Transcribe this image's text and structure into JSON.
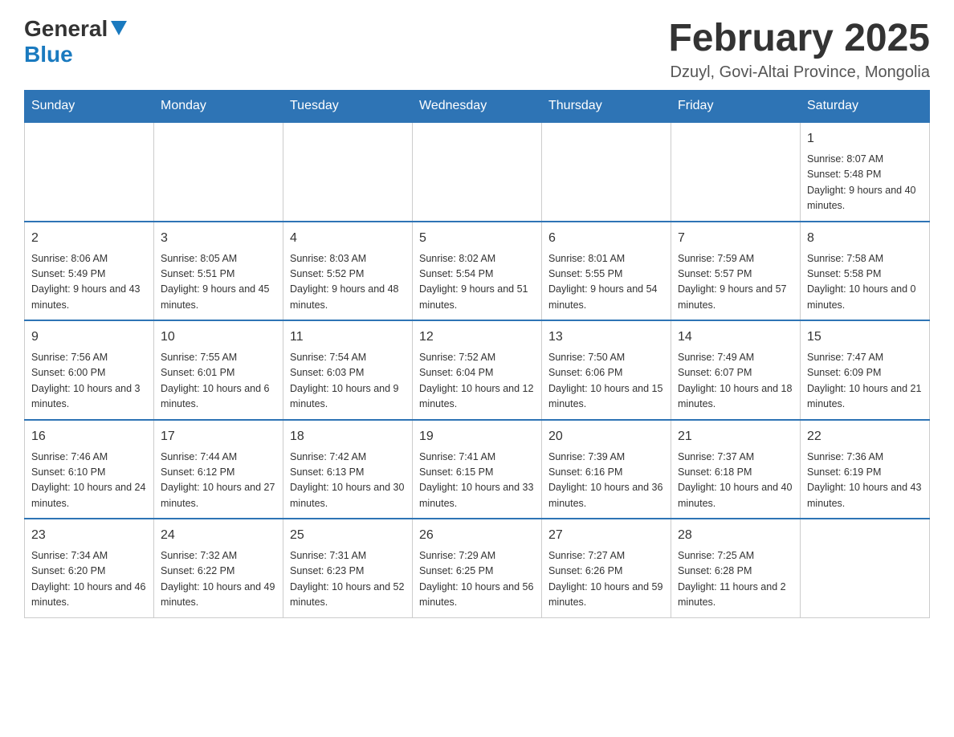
{
  "header": {
    "logo": {
      "general": "General",
      "blue": "Blue"
    },
    "title": "February 2025",
    "subtitle": "Dzuyl, Govi-Altai Province, Mongolia"
  },
  "weekdays": [
    "Sunday",
    "Monday",
    "Tuesday",
    "Wednesday",
    "Thursday",
    "Friday",
    "Saturday"
  ],
  "weeks": [
    [
      {
        "day": "",
        "info": ""
      },
      {
        "day": "",
        "info": ""
      },
      {
        "day": "",
        "info": ""
      },
      {
        "day": "",
        "info": ""
      },
      {
        "day": "",
        "info": ""
      },
      {
        "day": "",
        "info": ""
      },
      {
        "day": "1",
        "info": "Sunrise: 8:07 AM\nSunset: 5:48 PM\nDaylight: 9 hours and 40 minutes."
      }
    ],
    [
      {
        "day": "2",
        "info": "Sunrise: 8:06 AM\nSunset: 5:49 PM\nDaylight: 9 hours and 43 minutes."
      },
      {
        "day": "3",
        "info": "Sunrise: 8:05 AM\nSunset: 5:51 PM\nDaylight: 9 hours and 45 minutes."
      },
      {
        "day": "4",
        "info": "Sunrise: 8:03 AM\nSunset: 5:52 PM\nDaylight: 9 hours and 48 minutes."
      },
      {
        "day": "5",
        "info": "Sunrise: 8:02 AM\nSunset: 5:54 PM\nDaylight: 9 hours and 51 minutes."
      },
      {
        "day": "6",
        "info": "Sunrise: 8:01 AM\nSunset: 5:55 PM\nDaylight: 9 hours and 54 minutes."
      },
      {
        "day": "7",
        "info": "Sunrise: 7:59 AM\nSunset: 5:57 PM\nDaylight: 9 hours and 57 minutes."
      },
      {
        "day": "8",
        "info": "Sunrise: 7:58 AM\nSunset: 5:58 PM\nDaylight: 10 hours and 0 minutes."
      }
    ],
    [
      {
        "day": "9",
        "info": "Sunrise: 7:56 AM\nSunset: 6:00 PM\nDaylight: 10 hours and 3 minutes."
      },
      {
        "day": "10",
        "info": "Sunrise: 7:55 AM\nSunset: 6:01 PM\nDaylight: 10 hours and 6 minutes."
      },
      {
        "day": "11",
        "info": "Sunrise: 7:54 AM\nSunset: 6:03 PM\nDaylight: 10 hours and 9 minutes."
      },
      {
        "day": "12",
        "info": "Sunrise: 7:52 AM\nSunset: 6:04 PM\nDaylight: 10 hours and 12 minutes."
      },
      {
        "day": "13",
        "info": "Sunrise: 7:50 AM\nSunset: 6:06 PM\nDaylight: 10 hours and 15 minutes."
      },
      {
        "day": "14",
        "info": "Sunrise: 7:49 AM\nSunset: 6:07 PM\nDaylight: 10 hours and 18 minutes."
      },
      {
        "day": "15",
        "info": "Sunrise: 7:47 AM\nSunset: 6:09 PM\nDaylight: 10 hours and 21 minutes."
      }
    ],
    [
      {
        "day": "16",
        "info": "Sunrise: 7:46 AM\nSunset: 6:10 PM\nDaylight: 10 hours and 24 minutes."
      },
      {
        "day": "17",
        "info": "Sunrise: 7:44 AM\nSunset: 6:12 PM\nDaylight: 10 hours and 27 minutes."
      },
      {
        "day": "18",
        "info": "Sunrise: 7:42 AM\nSunset: 6:13 PM\nDaylight: 10 hours and 30 minutes."
      },
      {
        "day": "19",
        "info": "Sunrise: 7:41 AM\nSunset: 6:15 PM\nDaylight: 10 hours and 33 minutes."
      },
      {
        "day": "20",
        "info": "Sunrise: 7:39 AM\nSunset: 6:16 PM\nDaylight: 10 hours and 36 minutes."
      },
      {
        "day": "21",
        "info": "Sunrise: 7:37 AM\nSunset: 6:18 PM\nDaylight: 10 hours and 40 minutes."
      },
      {
        "day": "22",
        "info": "Sunrise: 7:36 AM\nSunset: 6:19 PM\nDaylight: 10 hours and 43 minutes."
      }
    ],
    [
      {
        "day": "23",
        "info": "Sunrise: 7:34 AM\nSunset: 6:20 PM\nDaylight: 10 hours and 46 minutes."
      },
      {
        "day": "24",
        "info": "Sunrise: 7:32 AM\nSunset: 6:22 PM\nDaylight: 10 hours and 49 minutes."
      },
      {
        "day": "25",
        "info": "Sunrise: 7:31 AM\nSunset: 6:23 PM\nDaylight: 10 hours and 52 minutes."
      },
      {
        "day": "26",
        "info": "Sunrise: 7:29 AM\nSunset: 6:25 PM\nDaylight: 10 hours and 56 minutes."
      },
      {
        "day": "27",
        "info": "Sunrise: 7:27 AM\nSunset: 6:26 PM\nDaylight: 10 hours and 59 minutes."
      },
      {
        "day": "28",
        "info": "Sunrise: 7:25 AM\nSunset: 6:28 PM\nDaylight: 11 hours and 2 minutes."
      },
      {
        "day": "",
        "info": ""
      }
    ]
  ]
}
